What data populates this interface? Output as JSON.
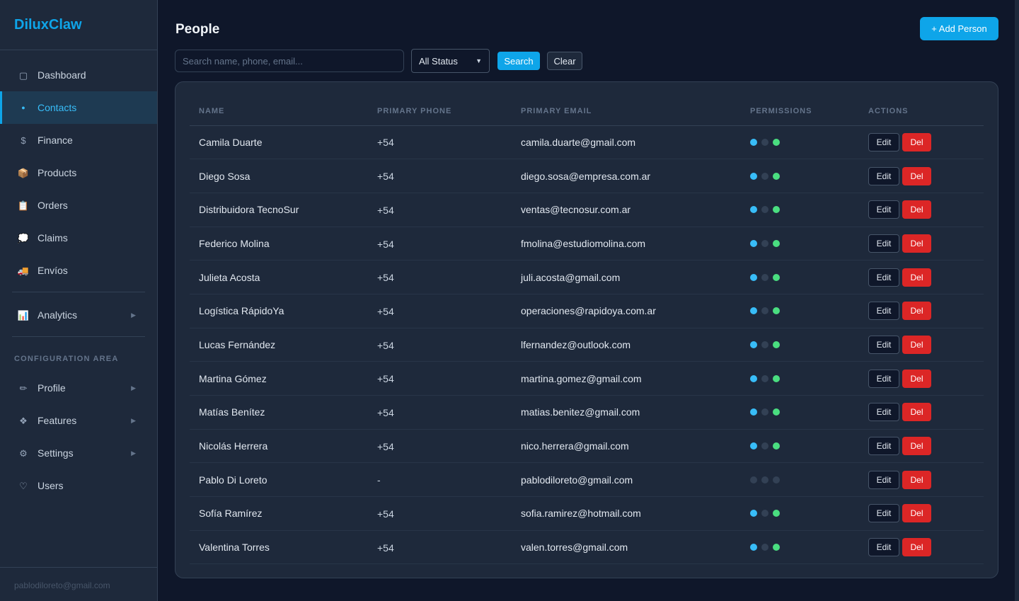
{
  "app": {
    "brand": "DiluxClaw",
    "user_email": "pablodiloreto@gmail.com"
  },
  "sidebar": {
    "items": [
      {
        "label": "Dashboard",
        "icon": "square-outline-icon",
        "glyph": "▢",
        "active": false
      },
      {
        "label": "Contacts",
        "icon": "circle-dot-icon",
        "glyph": "●",
        "active": true
      },
      {
        "label": "Finance",
        "icon": "dollar-icon",
        "glyph": "$",
        "active": false
      },
      {
        "label": "Products",
        "icon": "package-icon",
        "glyph": "📦",
        "active": false
      },
      {
        "label": "Orders",
        "icon": "clipboard-icon",
        "glyph": "📋",
        "active": false
      },
      {
        "label": "Claims",
        "icon": "speech-bubble-icon",
        "glyph": "💭",
        "active": false
      },
      {
        "label": "Envíos",
        "icon": "truck-icon",
        "glyph": "🚚",
        "active": false
      }
    ],
    "analytics": {
      "label": "Analytics",
      "icon": "bar-chart-icon",
      "glyph": "📊"
    },
    "config_label": "CONFIGURATION AREA",
    "config_items": [
      {
        "label": "Profile",
        "icon": "pencil-icon",
        "glyph": "✏",
        "has_arrow": true
      },
      {
        "label": "Features",
        "icon": "diamond-grid-icon",
        "glyph": "❖",
        "has_arrow": true
      },
      {
        "label": "Settings",
        "icon": "gear-icon",
        "glyph": "⚙",
        "has_arrow": true
      },
      {
        "label": "Users",
        "icon": "shield-icon",
        "glyph": "♡",
        "has_arrow": false
      }
    ]
  },
  "main": {
    "title": "People",
    "add_button": "+ Add Person",
    "search": {
      "placeholder": "Search name, phone, email...",
      "value": ""
    },
    "status_filter": {
      "selected": "All Status"
    },
    "search_button": "Search",
    "clear_button": "Clear"
  },
  "table": {
    "headers": [
      "NAME",
      "PRIMARY PHONE",
      "PRIMARY EMAIL",
      "PERMISSIONS",
      "ACTIONS"
    ],
    "edit_label": "Edit",
    "del_label": "Del",
    "permission_colors": {
      "on_1": "#38bdf8",
      "off": "#334155",
      "on_2": "#4ade80"
    },
    "rows": [
      {
        "name": "Camila Duarte",
        "phone": "+54!",
        "email": "camila.duarte@gmail.com",
        "perms": [
          true,
          false,
          true
        ]
      },
      {
        "name": "Diego Sosa",
        "phone": "+54!",
        "email": "diego.sosa@empresa.com.ar",
        "perms": [
          true,
          false,
          true
        ]
      },
      {
        "name": "Distribuidora TecnoSur",
        "phone": "+54!",
        "email": "ventas@tecnosur.com.ar",
        "perms": [
          true,
          false,
          true
        ]
      },
      {
        "name": "Federico Molina",
        "phone": "+54!",
        "email": "fmolina@estudiomolina.com",
        "perms": [
          true,
          false,
          true
        ]
      },
      {
        "name": "Julieta Acosta",
        "phone": "+54!",
        "email": "juli.acosta@gmail.com",
        "perms": [
          true,
          false,
          true
        ]
      },
      {
        "name": "Logística RápidoYa",
        "phone": "+54!",
        "email": "operaciones@rapidoya.com.ar",
        "perms": [
          true,
          false,
          true
        ]
      },
      {
        "name": "Lucas Fernández",
        "phone": "+54!",
        "email": "lfernandez@outlook.com",
        "perms": [
          true,
          false,
          true
        ]
      },
      {
        "name": "Martina Gómez",
        "phone": "+54!",
        "email": "martina.gomez@gmail.com",
        "perms": [
          true,
          false,
          true
        ]
      },
      {
        "name": "Matías Benítez",
        "phone": "+54!",
        "email": "matias.benitez@gmail.com",
        "perms": [
          true,
          false,
          true
        ]
      },
      {
        "name": "Nicolás Herrera",
        "phone": "+54!",
        "email": "nico.herrera@gmail.com",
        "perms": [
          true,
          false,
          true
        ]
      },
      {
        "name": "Pablo Di Loreto",
        "phone": "-",
        "email": "pablodiloreto@gmail.com",
        "perms": [
          false,
          false,
          false
        ]
      },
      {
        "name": "Sofía Ramírez",
        "phone": "+54!",
        "email": "sofia.ramirez@hotmail.com",
        "perms": [
          true,
          false,
          true
        ]
      },
      {
        "name": "Valentina Torres",
        "phone": "+54!",
        "email": "valen.torres@gmail.com",
        "perms": [
          true,
          false,
          true
        ]
      }
    ]
  }
}
